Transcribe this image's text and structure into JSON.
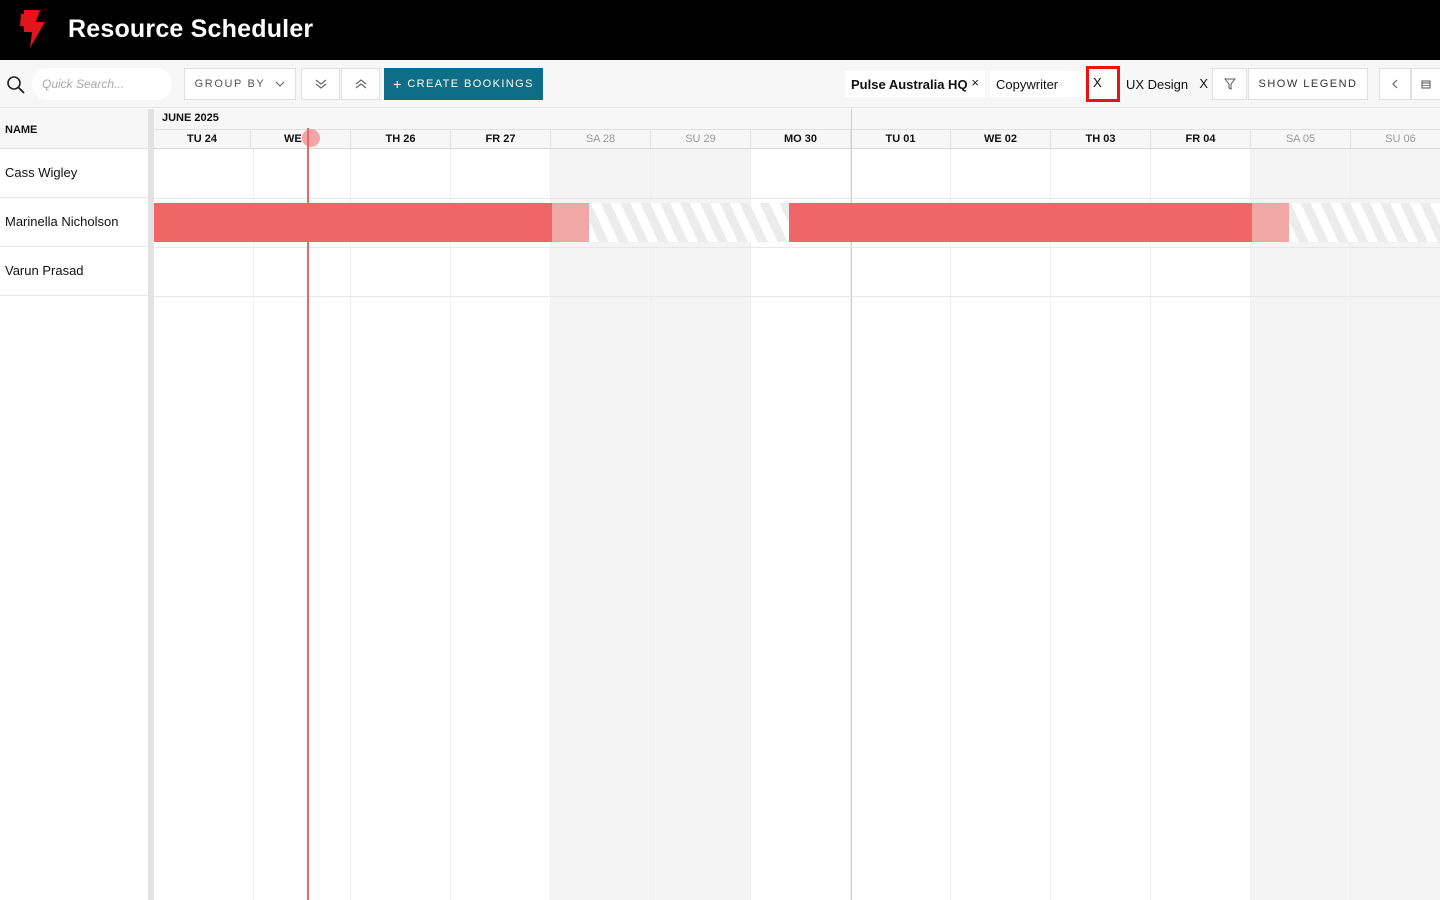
{
  "header": {
    "title": "Resource Scheduler",
    "logo_icon": "lightning-bolt-logo",
    "logo_color": "#e0161b"
  },
  "toolbar": {
    "search_placeholder": "Quick Search...",
    "group_by_label": "GROUP BY",
    "create_label": "CREATE BOOKINGS",
    "create_plus": "+",
    "show_legend_label": "SHOW LEGEND",
    "accent_color": "#0f6e87"
  },
  "filters": [
    {
      "label": "Pulse Australia HQ",
      "remove": "×"
    },
    {
      "label": "Copywriter",
      "remove": "X"
    },
    {
      "label": "UX Design",
      "remove": "X"
    }
  ],
  "grid": {
    "name_header": "NAME",
    "month_label": "JUNE 2025",
    "days": [
      {
        "label": "TU 24",
        "weekend": false
      },
      {
        "label": "WE 25",
        "weekend": false
      },
      {
        "label": "TH 26",
        "weekend": false
      },
      {
        "label": "FR 27",
        "weekend": false
      },
      {
        "label": "SA 28",
        "weekend": true
      },
      {
        "label": "SU 29",
        "weekend": true
      },
      {
        "label": "MO 30",
        "weekend": false
      },
      {
        "label": "TU 01",
        "weekend": false
      },
      {
        "label": "WE 02",
        "weekend": false
      },
      {
        "label": "TH 03",
        "weekend": false
      },
      {
        "label": "FR 04",
        "weekend": false
      },
      {
        "label": "SA 05",
        "weekend": true
      },
      {
        "label": "SU 06",
        "weekend": true
      }
    ],
    "resources": [
      {
        "name": "Cass Wigley"
      },
      {
        "name": "Marinella Nicholson"
      },
      {
        "name": "Varun Prasad"
      }
    ],
    "booking_color": "#f06666",
    "today": "WE 25"
  }
}
